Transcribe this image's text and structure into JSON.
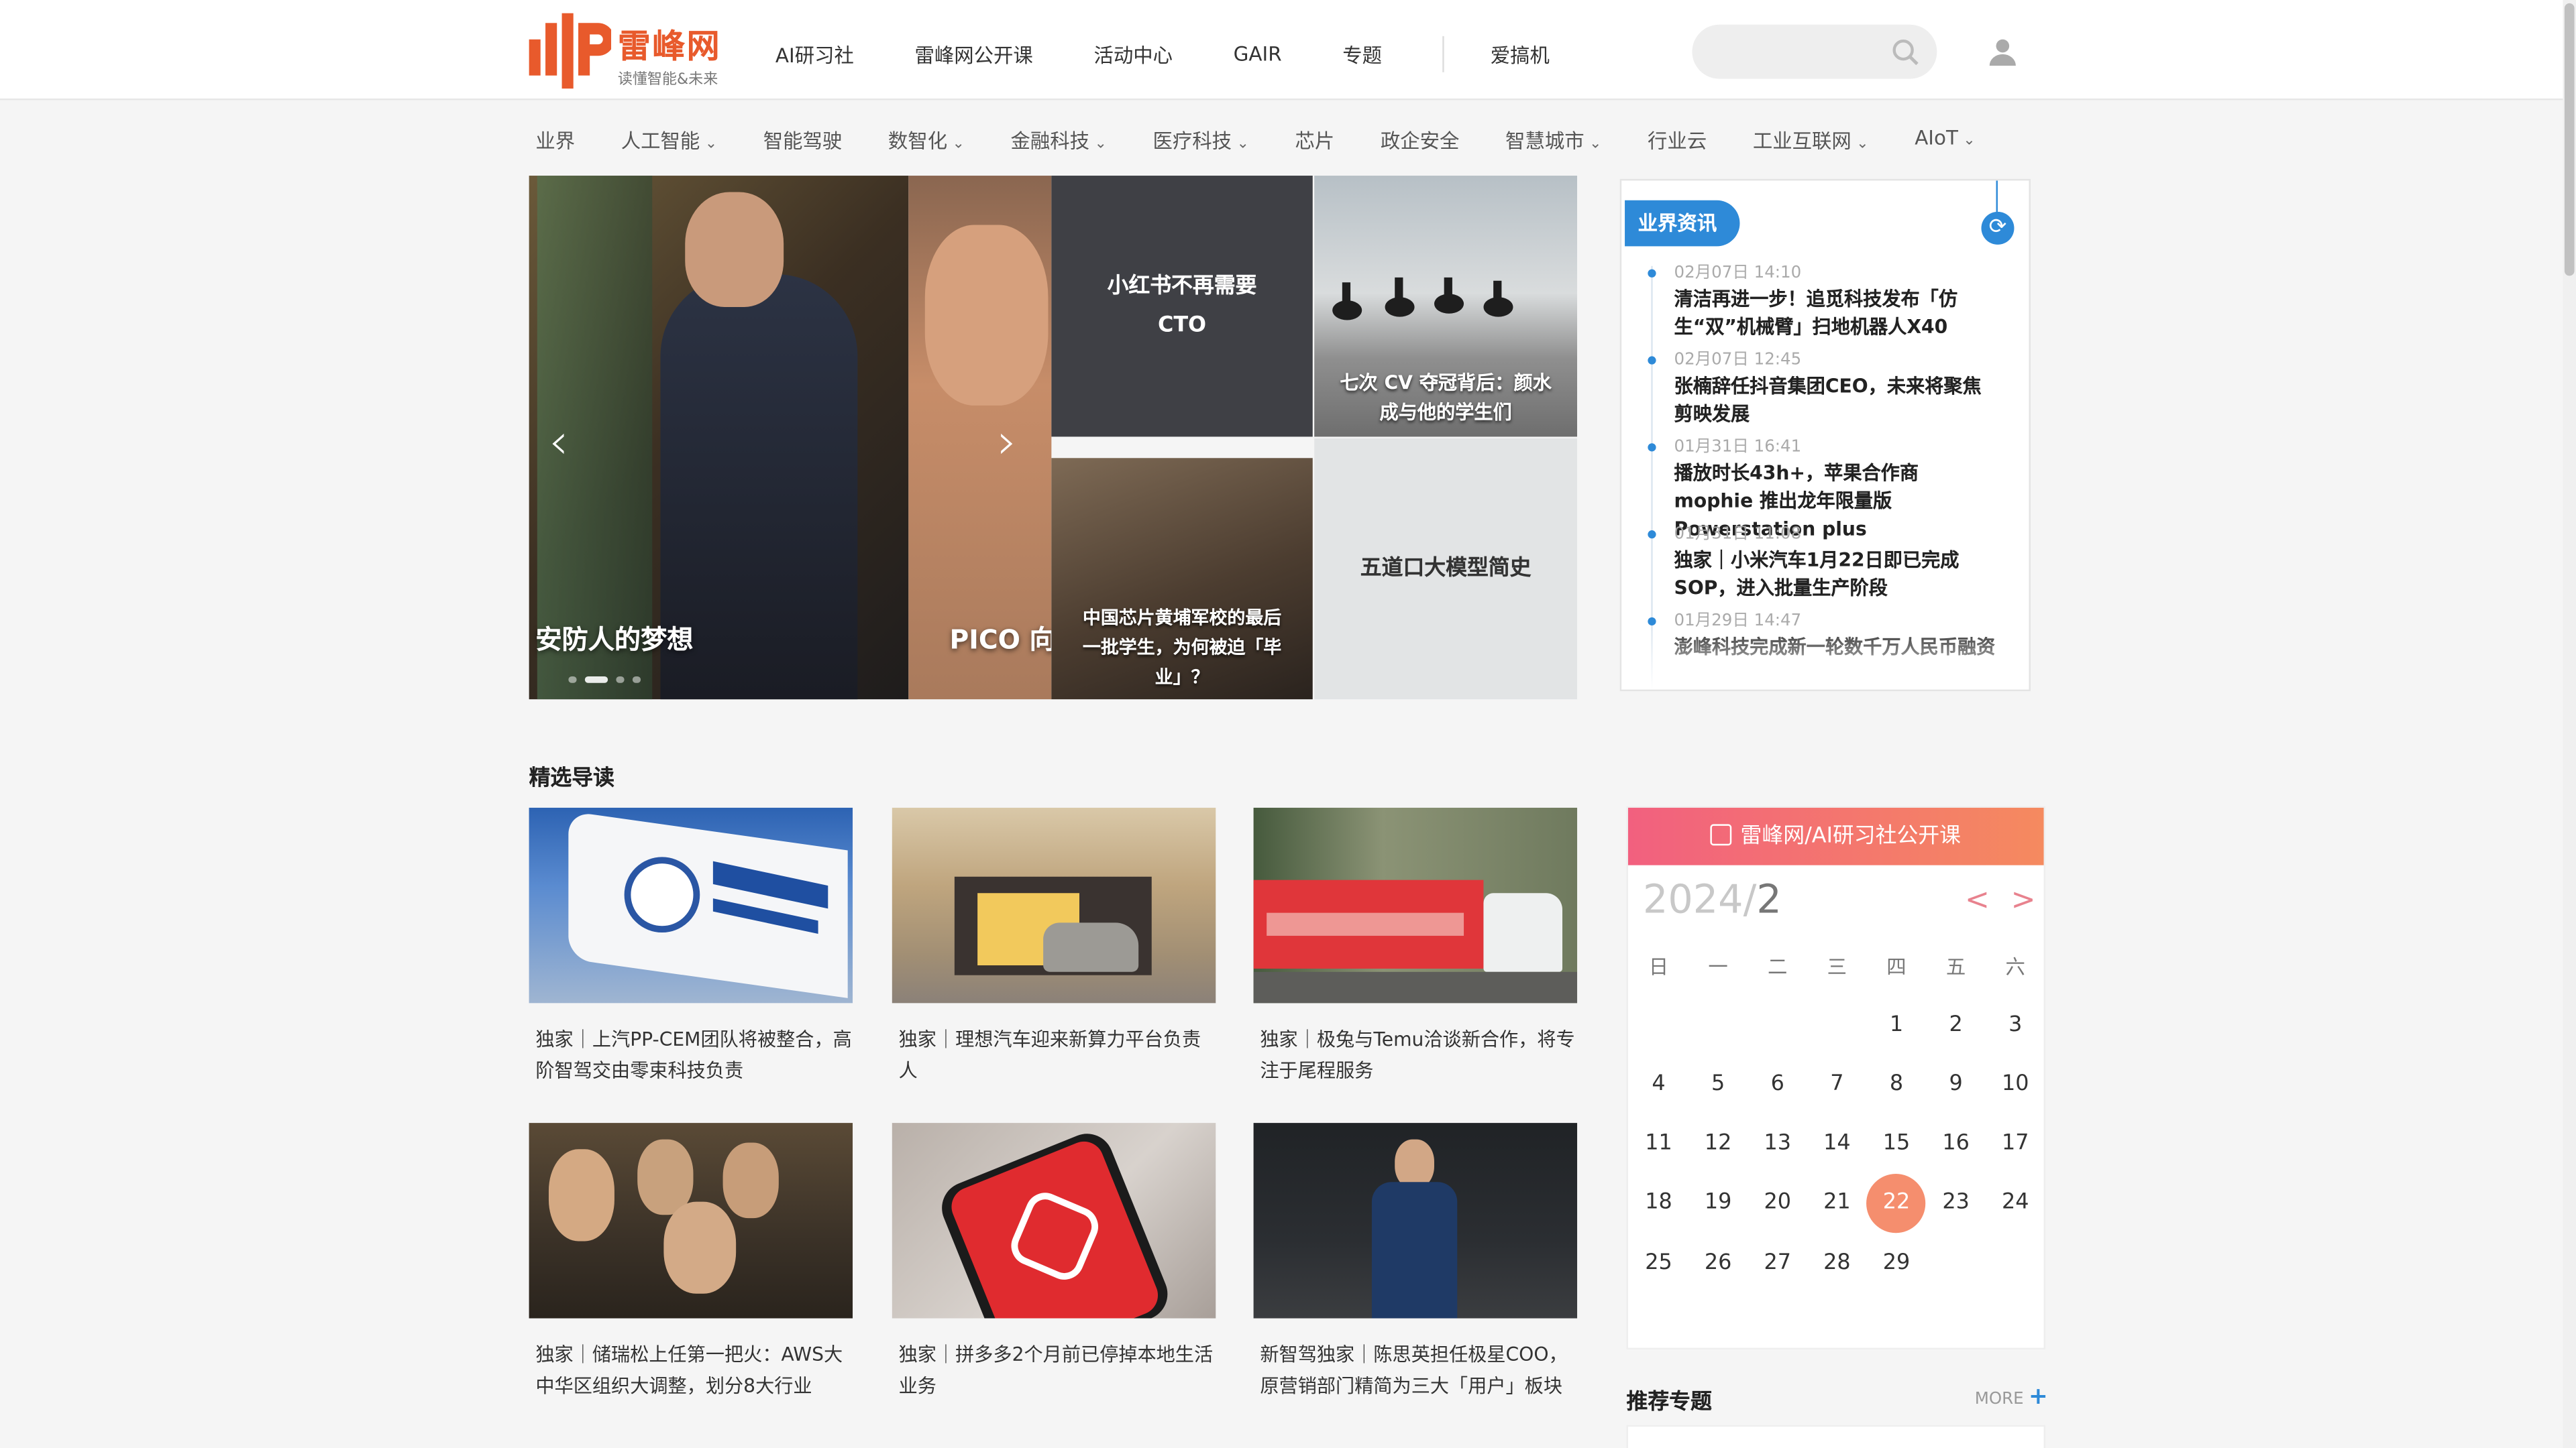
{
  "header": {
    "logo_text": "雷峰网",
    "logo_tagline": "读懂智能&未来",
    "nav": [
      "AI研习社",
      "雷峰网公开课",
      "活动中心",
      "GAIR",
      "专题"
    ],
    "nav_extra": "爱搞机",
    "search_placeholder": ""
  },
  "categories": [
    {
      "label": "业界",
      "dropdown": false
    },
    {
      "label": "人工智能",
      "dropdown": true
    },
    {
      "label": "智能驾驶",
      "dropdown": false
    },
    {
      "label": "数智化",
      "dropdown": true
    },
    {
      "label": "金融科技",
      "dropdown": true
    },
    {
      "label": "医疗科技",
      "dropdown": true
    },
    {
      "label": "芯片",
      "dropdown": false
    },
    {
      "label": "政企安全",
      "dropdown": false
    },
    {
      "label": "智慧城市",
      "dropdown": true
    },
    {
      "label": "行业云",
      "dropdown": false
    },
    {
      "label": "工业互联网",
      "dropdown": true
    },
    {
      "label": "AIoT",
      "dropdown": true
    }
  ],
  "carousel": {
    "captions": [
      "安防人的梦想",
      "PICO 向"
    ],
    "arrow_left": "‹",
    "arrow_right": "›"
  },
  "tiles": [
    "小红书不再需要CTO",
    "七次 CV 夺冠背后：颜水成与他的学生们",
    "中国芯片黄埔军校的最后一批学生，为何被迫「毕业」？",
    "五道口大模型简史"
  ],
  "industry_news": {
    "title": "业界资讯",
    "items": [
      {
        "time": "02月07日 14:10",
        "title": "清洁再进一步！追觅科技发布「仿生“双”机械臂」扫地机器人X40"
      },
      {
        "time": "02月07日 12:45",
        "title": "张楠辞任抖音集团CEO，未来将聚焦剪映发展"
      },
      {
        "time": "01月31日 16:41",
        "title": "播放时长43h+，苹果合作商 mophie 推出龙年限量版 Powerstation plus"
      },
      {
        "time": "01月31日 11:08",
        "title": "独家｜小米汽车1月22日即已完成SOP，进入批量生产阶段"
      },
      {
        "time": "01月29日 14:47",
        "title": "澎峰科技完成新一轮数千万人民币融资"
      }
    ]
  },
  "featured": {
    "title": "精选导读",
    "cards": [
      {
        "title": "独家｜上汽PP-CEM团队将被整合，高阶智驾交由零束科技负责"
      },
      {
        "title": "独家｜理想汽车迎来新算力平台负责人"
      },
      {
        "title": "独家｜极兔与Temu洽谈新合作，将专注于尾程服务"
      },
      {
        "title": "独家｜储瑞松上任第一把火：AWS大中华区组织大调整，划分8大行业"
      },
      {
        "title": "独家｜拼多多2个月前已停掉本地生活业务"
      },
      {
        "title": "新智驾独家｜陈思英担任极星COO，原营销部门精简为三大「用户」板块"
      }
    ]
  },
  "calendar": {
    "header": "雷峰网/AI研习社公开课",
    "year": "2024/",
    "month": "2",
    "prev": "<",
    "next": ">",
    "weekdays": [
      "日",
      "一",
      "二",
      "三",
      "四",
      "五",
      "六"
    ],
    "first_weekday": 4,
    "days_in_month": 29,
    "today": 22
  },
  "topics": {
    "title": "推荐专题",
    "more": "MORE"
  },
  "colors": {
    "brand": "#e85a2c",
    "accent_blue": "#2e8ad8",
    "calendar_today": "#f58e6e"
  }
}
